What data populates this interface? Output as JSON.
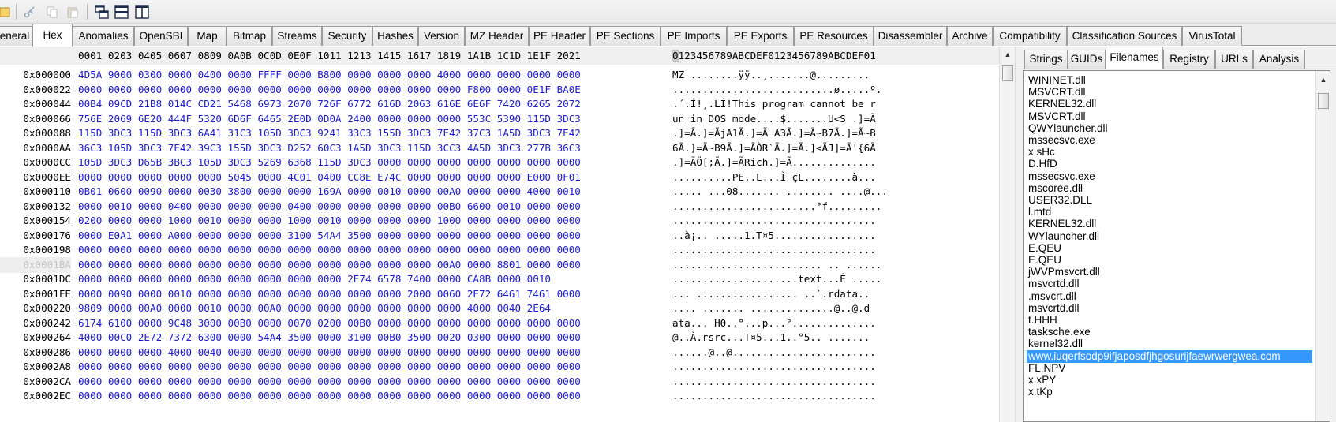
{
  "toolbar": {
    "icons": [
      "open-icon",
      "cut-icon",
      "copy-icon",
      "paste-icon",
      "cascade-windows-icon",
      "tile-horizontal-icon",
      "tile-vertical-icon"
    ]
  },
  "tabs": [
    {
      "label": "eneral",
      "active": false
    },
    {
      "label": "Hex",
      "active": true
    },
    {
      "label": "Anomalies",
      "active": false
    },
    {
      "label": "OpenSBI",
      "active": false
    },
    {
      "label": "Map",
      "active": false
    },
    {
      "label": "Bitmap",
      "active": false
    },
    {
      "label": "Streams",
      "active": false
    },
    {
      "label": "Security",
      "active": false
    },
    {
      "label": "Hashes",
      "active": false
    },
    {
      "label": "Version",
      "active": false
    },
    {
      "label": "MZ Header",
      "active": false
    },
    {
      "label": "PE Header",
      "active": false
    },
    {
      "label": "PE Sections",
      "active": false
    },
    {
      "label": "PE Imports",
      "active": false
    },
    {
      "label": "PE Exports",
      "active": false
    },
    {
      "label": "PE Resources",
      "active": false
    },
    {
      "label": "Disassembler",
      "active": false
    },
    {
      "label": "Archive",
      "active": false
    },
    {
      "label": "Compatibility",
      "active": false
    },
    {
      "label": "Classification Sources",
      "active": false
    },
    {
      "label": "VirusTotal",
      "active": false
    }
  ],
  "hex": {
    "header_hex": "0001 0203 0405 0607 0809 0A0B 0C0D 0E0F 1011 1213 1415 1617 1819 1A1B 1C1D 1E1F 2021",
    "header_ascii_caret": "0",
    "header_ascii": "123456789ABCDEF0123456789ABCDEF01",
    "rows": [
      {
        "offset": "0x000000",
        "hex": "4D5A 9000 0300 0000 0400 0000 FFFF 0000 B800 0000 0000 0000 4000 0000 0000 0000 0000",
        "ascii": "MZ ........ÿÿ..¸.......@.........",
        "selected": false
      },
      {
        "offset": "0x000022",
        "hex": "0000 0000 0000 0000 0000 0000 0000 0000 0000 0000 0000 0000 0000 F800 0000 0E1F BA0E",
        "ascii": "...........................ø.....º.",
        "selected": false
      },
      {
        "offset": "0x000044",
        "hex": "00B4 09CD 21B8 014C CD21 5468 6973 2070 726F 6772 616D 2063 616E 6E6F 7420 6265 2072",
        "ascii": ".´.Í!¸.LÍ!This program cannot be r",
        "selected": false
      },
      {
        "offset": "0x000066",
        "hex": "756E 2069 6E20 444F 5320 6D6F 6465 2E0D 0D0A 2400 0000 0000 0000 553C 5390 115D 3DC3",
        "ascii": "un in DOS mode....$.......U<S .]=Ã",
        "selected": false
      },
      {
        "offset": "0x000088",
        "hex": "115D 3DC3 115D 3DC3 6A41 31C3 105D 3DC3 9241 33C3 155D 3DC3 7E42 37C3 1A5D 3DC3 7E42",
        "ascii": ".]=Ã.]=ÃjA1Ã.]=Ã A3Ã.]=Ã~B7Ã.]=Ã~B",
        "selected": false
      },
      {
        "offset": "0x0000AA",
        "hex": "36C3 105D 3DC3 7E42 39C3 155D 3DC3 D252 60C3 1A5D 3DC3 115D 3CC3 4A5D 3DC3 277B 36C3",
        "ascii": "6Ã.]=Ã~B9Ã.]=ÃÒR`Ã.]=Ã.]<ÃJ]=Ã'{6Ã",
        "selected": false
      },
      {
        "offset": "0x0000CC",
        "hex": "105D 3DC3 D65B 3BC3 105D 3DC3 5269 6368 115D 3DC3 0000 0000 0000 0000 0000 0000 0000",
        "ascii": ".]=ÃÖ[;Ã.]=ÃRich.]=Ã..............",
        "selected": false
      },
      {
        "offset": "0x0000EE",
        "hex": "0000 0000 0000 0000 0000 5045 0000 4C01 0400 CC8E E74C 0000 0000 0000 0000 E000 0F01",
        "ascii": "..........PE..L...Ì çL........à...",
        "selected": false
      },
      {
        "offset": "0x000110",
        "hex": "0B01 0600 0090 0000 0030 3800 0000 0000 169A 0000 0010 0000 00A0 0000 0000 4000 0010",
        "ascii": "..... ...08....... ........ ....@...",
        "selected": false
      },
      {
        "offset": "0x000132",
        "hex": "0000 0010 0000 0400 0000 0000 0000 0400 0000 0000 0000 0000 00B0 6600 0010 0000 0000",
        "ascii": "........................°f.........",
        "selected": false
      },
      {
        "offset": "0x000154",
        "hex": "0200 0000 0000 1000 0010 0000 0000 1000 0010 0000 0000 0000 1000 0000 0000 0000 0000",
        "ascii": "..................................",
        "selected": false
      },
      {
        "offset": "0x000176",
        "hex": "0000 E0A1 0000 A000 0000 0000 0000 3100 54A4 3500 0000 0000 0000 0000 0000 0000 0000",
        "ascii": "..à¡.. .....1.T¤5.................",
        "selected": false
      },
      {
        "offset": "0x000198",
        "hex": "0000 0000 0000 0000 0000 0000 0000 0000 0000 0000 0000 0000 0000 0000 0000 0000 0000",
        "ascii": "..................................",
        "selected": false
      },
      {
        "offset": "0x0001BA",
        "hex": "0000 0000 0000 0000 0000 0000 0000 0000 0000 0000 0000 0000 00A0 0000 8801 0000 0000",
        "ascii": "......................... .. ......",
        "selected": true
      },
      {
        "offset": "0x0001DC",
        "hex": "0000 0000 0000 0000 0000 0000 0000 0000 0000 2E74 6578 7400 0000 CA8B 0000 0010",
        "ascii": ".....................text...Ê .....",
        "selected": false
      },
      {
        "offset": "0x0001FE",
        "hex": "0000 0090 0000 0010 0000 0000 0000 0000 0000 0000 0000 2000 0060 2E72 6461 7461 0000",
        "ascii": "... ................. ..`.rdata..",
        "selected": false
      },
      {
        "offset": "0x000220",
        "hex": "9809 0000 00A0 0000 0010 0000 00A0 0000 0000 0000 0000 0000 0000 4000 0040 2E64",
        "ascii": ".... ....... ..............@..@.d",
        "selected": false
      },
      {
        "offset": "0x000242",
        "hex": "6174 6100 0000 9C48 3000 00B0 0000 0070 0200 00B0 0000 0000 0000 0000 0000 0000 0000",
        "ascii": "ata... H0..°...p...°..............",
        "selected": false
      },
      {
        "offset": "0x000264",
        "hex": "4000 00C0 2E72 7372 6300 0000 54A4 3500 0000 3100 00B0 3500 0020 0300 0000 0000 0000",
        "ascii": "@..À.rsrc...T¤5...1..°5.. .......",
        "selected": false
      },
      {
        "offset": "0x000286",
        "hex": "0000 0000 0000 4000 0040 0000 0000 0000 0000 0000 0000 0000 0000 0000 0000 0000 0000",
        "ascii": "......@..@........................",
        "selected": false
      },
      {
        "offset": "0x0002A8",
        "hex": "0000 0000 0000 0000 0000 0000 0000 0000 0000 0000 0000 0000 0000 0000 0000 0000 0000",
        "ascii": "..................................",
        "selected": false
      },
      {
        "offset": "0x0002CA",
        "hex": "0000 0000 0000 0000 0000 0000 0000 0000 0000 0000 0000 0000 0000 0000 0000 0000 0000",
        "ascii": "..................................",
        "selected": false
      },
      {
        "offset": "0x0002EC",
        "hex": "0000 0000 0000 0000 0000 0000 0000 0000 0000 0000 0000 0000 0000 0000 0000 0000 0000",
        "ascii": "..................................",
        "selected": false
      }
    ]
  },
  "side_tabs": [
    {
      "label": "Strings",
      "active": false
    },
    {
      "label": "GUIDs",
      "active": false
    },
    {
      "label": "Filenames",
      "active": true
    },
    {
      "label": "Registry",
      "active": false
    },
    {
      "label": "URLs",
      "active": false
    },
    {
      "label": "Analysis",
      "active": false
    }
  ],
  "filenames": [
    {
      "name": "WININET.dll",
      "selected": false
    },
    {
      "name": "MSVCRT.dll",
      "selected": false
    },
    {
      "name": "KERNEL32.dll",
      "selected": false
    },
    {
      "name": "MSVCRT.dll",
      "selected": false
    },
    {
      "name": "QWYlauncher.dll",
      "selected": false
    },
    {
      "name": "mssecsvc.exe",
      "selected": false
    },
    {
      "name": "x.sHc",
      "selected": false
    },
    {
      "name": "D.HfD",
      "selected": false
    },
    {
      "name": "mssecsvc.exe",
      "selected": false
    },
    {
      "name": "mscoree.dll",
      "selected": false
    },
    {
      "name": "USER32.DLL",
      "selected": false
    },
    {
      "name": "l.mtd",
      "selected": false
    },
    {
      "name": "KERNEL32.dll",
      "selected": false
    },
    {
      "name": "WYlauncher.dll",
      "selected": false
    },
    {
      "name": "E.QEU",
      "selected": false
    },
    {
      "name": "E.QEU",
      "selected": false
    },
    {
      "name": "jWVPmsvcrt.dll",
      "selected": false
    },
    {
      "name": "msvcrtd.dll",
      "selected": false
    },
    {
      "name": ".msvcrt.dll",
      "selected": false
    },
    {
      "name": "msvcrtd.dll",
      "selected": false
    },
    {
      "name": "t.HHH",
      "selected": false
    },
    {
      "name": "tasksche.exe",
      "selected": false
    },
    {
      "name": "kernel32.dll",
      "selected": false
    },
    {
      "name": "www.iuqerfsodp9ifjaposdfjhgosurijfaewrwergwea.com",
      "selected": true
    },
    {
      "name": "FL.NPV",
      "selected": false
    },
    {
      "name": "x.xPY",
      "selected": false
    },
    {
      "name": "x.tKp",
      "selected": false
    }
  ],
  "colors": {
    "hex_text": "#1b1bd8",
    "selection": "#3399ff"
  }
}
